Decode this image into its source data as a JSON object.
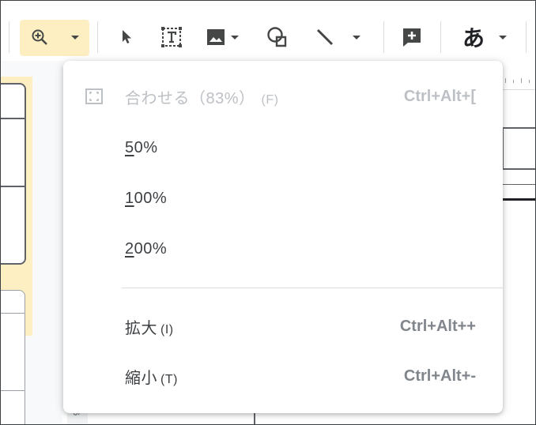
{
  "toolbar": {
    "text_tool_glyph": "あ",
    "buttons": [
      {
        "name": "zoom",
        "icon": "zoom-in-icon"
      },
      {
        "name": "zoom-dropdown",
        "icon": "caret-down-icon"
      },
      {
        "name": "select",
        "icon": "cursor-arrow-icon"
      },
      {
        "name": "text-box",
        "icon": "text-box-icon"
      },
      {
        "name": "image",
        "icon": "image-icon"
      },
      {
        "name": "shape",
        "icon": "shape-icon"
      },
      {
        "name": "line",
        "icon": "line-icon"
      },
      {
        "name": "comment",
        "icon": "add-comment-icon"
      },
      {
        "name": "text-input",
        "icon": "hiragana-a-icon"
      }
    ]
  },
  "zoom_menu": {
    "items": [
      {
        "key": "fit",
        "label": "合わせる（83%）",
        "mnemonic": "(F)",
        "shortcut": "Ctrl+Alt+[",
        "disabled": true,
        "icon": "fit-screen-icon"
      },
      {
        "key": "50",
        "label_underlined": "5",
        "label_rest": "0%"
      },
      {
        "key": "100",
        "label_underlined": "1",
        "label_rest": "00%"
      },
      {
        "key": "200",
        "label_underlined": "2",
        "label_rest": "00%"
      },
      {
        "key": "zoom-in",
        "label": "拡大",
        "mnemonic": "(I)",
        "shortcut": "Ctrl+Alt++"
      },
      {
        "key": "zoom-out",
        "label": "縮小",
        "mnemonic": "(T)",
        "shortcut": "Ctrl+Alt+-"
      }
    ]
  },
  "ruler": {
    "bottom_tick": "6"
  },
  "colors": {
    "zoom_active_bg": "#feefc3",
    "menu_bg": "#ffffff",
    "disabled_text": "#bdc1c6",
    "shortcut_text": "#80868b"
  }
}
